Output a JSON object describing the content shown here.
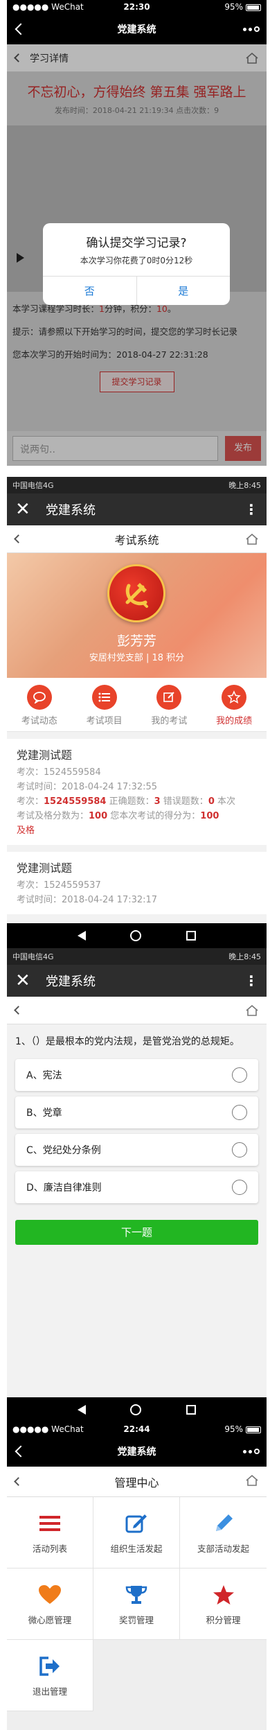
{
  "panel1": {
    "status": {
      "carrier": "●●●●● WeChat",
      "time": "22:30",
      "battery": "95%"
    },
    "nav_title": "党建系统",
    "sub_nav_label": "学习详情",
    "title": "不忘初心，方得始终 第五集 强军路上",
    "meta": "发布时间：2018-04-21 21:19:34  点击次数：9",
    "duration_prefix": "本学习课程学习时长：",
    "duration_value": "1",
    "duration_mid": "分钟，积分：",
    "points_value": "10",
    "duration_suffix": "。",
    "tip": "提示：请参照以下开始学习的时间，提交您的学习时长记录",
    "start_time": "您本次学习的开始时间为：2018-04-27 22:31:28",
    "submit_label": "提交学习记录",
    "comment_placeholder": "说两句..",
    "send_label": "发布",
    "dialog": {
      "title": "确认提交学习记录?",
      "message": "本次学习你花费了0时0分12秒",
      "cancel": "否",
      "confirm": "是"
    }
  },
  "panel2": {
    "status": {
      "carrier": "中国电信4G",
      "time": "晚上8:45"
    },
    "app_title": "党建系统",
    "sub_title": "考试系统",
    "user_name": "彭芳芳",
    "user_branch": "安居村党支部 | 18 积分",
    "tabs": [
      {
        "label": "考试动态",
        "icon": "chat-bubble-icon"
      },
      {
        "label": "考试项目",
        "icon": "list-icon"
      },
      {
        "label": "我的考试",
        "icon": "edit-icon"
      },
      {
        "label": "我的成绩",
        "icon": "star-icon"
      }
    ],
    "records": [
      {
        "title": "党建测试题",
        "exam_no": "考次：1524559584",
        "exam_time": "考试时间：2018-04-24 17:32:55",
        "line3_prefix": "考次：",
        "line3_no": "1524559584",
        "line3_correct_label": "  正确题数：",
        "line3_correct": "3",
        "line3_wrong_label": "  错误题数：",
        "line3_wrong": "0",
        "line3_suffix": "  本次",
        "line4_label": "考试及格分数为：",
        "pass_score": "100",
        "line4_mid": "  您本次考试的得分为：",
        "score": "100",
        "result": "及格"
      },
      {
        "title": "党建测试题",
        "exam_no": "考次：1524559537",
        "exam_time": "考试时间：2018-04-24 17:32:17"
      }
    ]
  },
  "panel3": {
    "status": {
      "carrier": "中国电信4G",
      "time": "晚上8:45"
    },
    "app_title": "党建系统",
    "question": "1、（）是最根本的党内法规，是管党治党的总规矩。",
    "options": [
      "A、宪法",
      "B、党章",
      "C、党纪处分条例",
      "D、廉洁自律准则"
    ],
    "next_label": "下一题"
  },
  "panel4": {
    "status": {
      "carrier": "●●●●● WeChat",
      "time": "22:44",
      "battery": "95%"
    },
    "nav_title": "党建系统",
    "sub_title": "管理中心",
    "items": [
      {
        "label": "活动列表",
        "icon": "menu-list-icon",
        "color": "#d0262a"
      },
      {
        "label": "组织生活发起",
        "icon": "edit-square-icon",
        "color": "#1e6fc9"
      },
      {
        "label": "支部活动发起",
        "icon": "pencil-icon",
        "color": "#3b8fe0"
      },
      {
        "label": "微心愿管理",
        "icon": "heart-icon",
        "color": "#f07c1a"
      },
      {
        "label": "奖罚管理",
        "icon": "trophy-icon",
        "color": "#1e6fc9"
      },
      {
        "label": "积分管理",
        "icon": "star-icon",
        "color": "#d0262a"
      },
      {
        "label": "退出管理",
        "icon": "logout-icon",
        "color": "#1e6fc9"
      }
    ]
  }
}
